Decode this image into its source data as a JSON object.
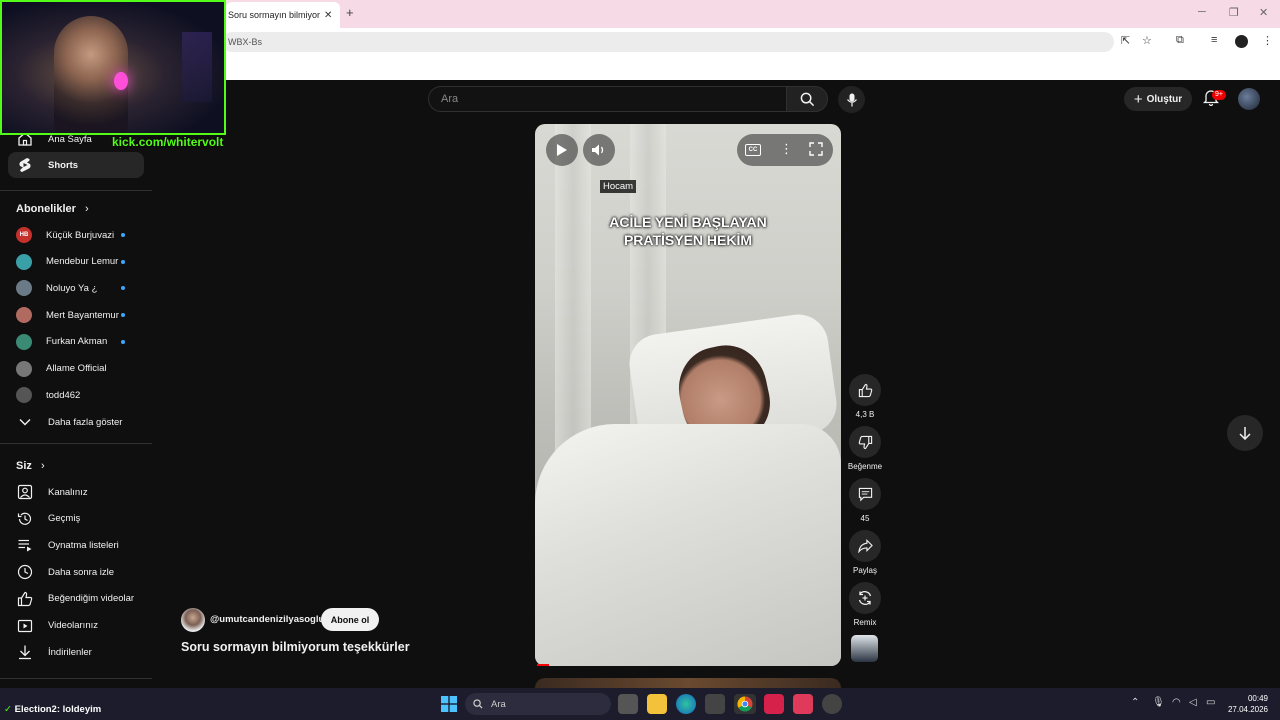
{
  "browser": {
    "tab_title": "Soru sormayın bilmiyorum",
    "tab_close": "✕",
    "new_tab": "+",
    "url_fragment": "WBX-Bs"
  },
  "header": {
    "search_placeholder": "Ara",
    "create_label": "Oluştur",
    "notif_count": "9+"
  },
  "sidebar": {
    "top_items": [
      {
        "label": "Ana Sayfa",
        "icon": "home-icon"
      },
      {
        "label": "Shorts",
        "icon": "shorts-icon"
      }
    ],
    "subs_header": "Abonelikler",
    "subscriptions": [
      {
        "name": "Küçük Burjuvazi",
        "badge": "HB",
        "color": "#c4302b",
        "live": true
      },
      {
        "name": "Mendebur Lemur",
        "color": "#3aa0a8",
        "live": true
      },
      {
        "name": "Noluyo Ya ¿",
        "color": "#6a7a86",
        "live": true
      },
      {
        "name": "Mert Bayantemur",
        "color": "#b06a60",
        "live": true
      },
      {
        "name": "Furkan Akman",
        "color": "#3a8a74",
        "live": true
      },
      {
        "name": "Allame Official",
        "color": "#777777",
        "live": false
      },
      {
        "name": "todd462",
        "color": "#555555",
        "live": false
      }
    ],
    "show_more": "Daha fazla göster",
    "you_header": "Siz",
    "you_items": [
      {
        "label": "Kanalınız",
        "icon": "channel-icon"
      },
      {
        "label": "Geçmiş",
        "icon": "history-icon"
      },
      {
        "label": "Oynatma listeleri",
        "icon": "playlists-icon"
      },
      {
        "label": "Daha sonra izle",
        "icon": "watch-later-icon"
      },
      {
        "label": "Beğendiğim videolar",
        "icon": "liked-icon"
      },
      {
        "label": "Videolarınız",
        "icon": "your-videos-icon"
      },
      {
        "label": "İndirilenler",
        "icon": "downloads-icon"
      }
    ]
  },
  "overlay": {
    "kick_url": "kick.com/whitervolt",
    "election_key": "Election2:",
    "election_text": "loldeyim"
  },
  "short": {
    "caption_tag": "Hocam",
    "overlay_line1": "ACİLE YENİ BAŞLAYAN",
    "overlay_line2": "PRATİSYEN HEKİM",
    "cc": "CC",
    "progress_fraction": 0.04
  },
  "actions": {
    "like_count": "4,3 B",
    "dislike_label": "Beğenme",
    "comments_count": "45",
    "share_label": "Paylaş",
    "remix_label": "Remix"
  },
  "channel": {
    "handle": "@umutcandenizilyasoglu",
    "subscribe_label": "Abone ol",
    "video_title": "Soru sormayın bilmiyorum teşekkürler"
  },
  "taskbar": {
    "search_label": "Ara",
    "time": "00:49",
    "date": "27.04.2026"
  }
}
